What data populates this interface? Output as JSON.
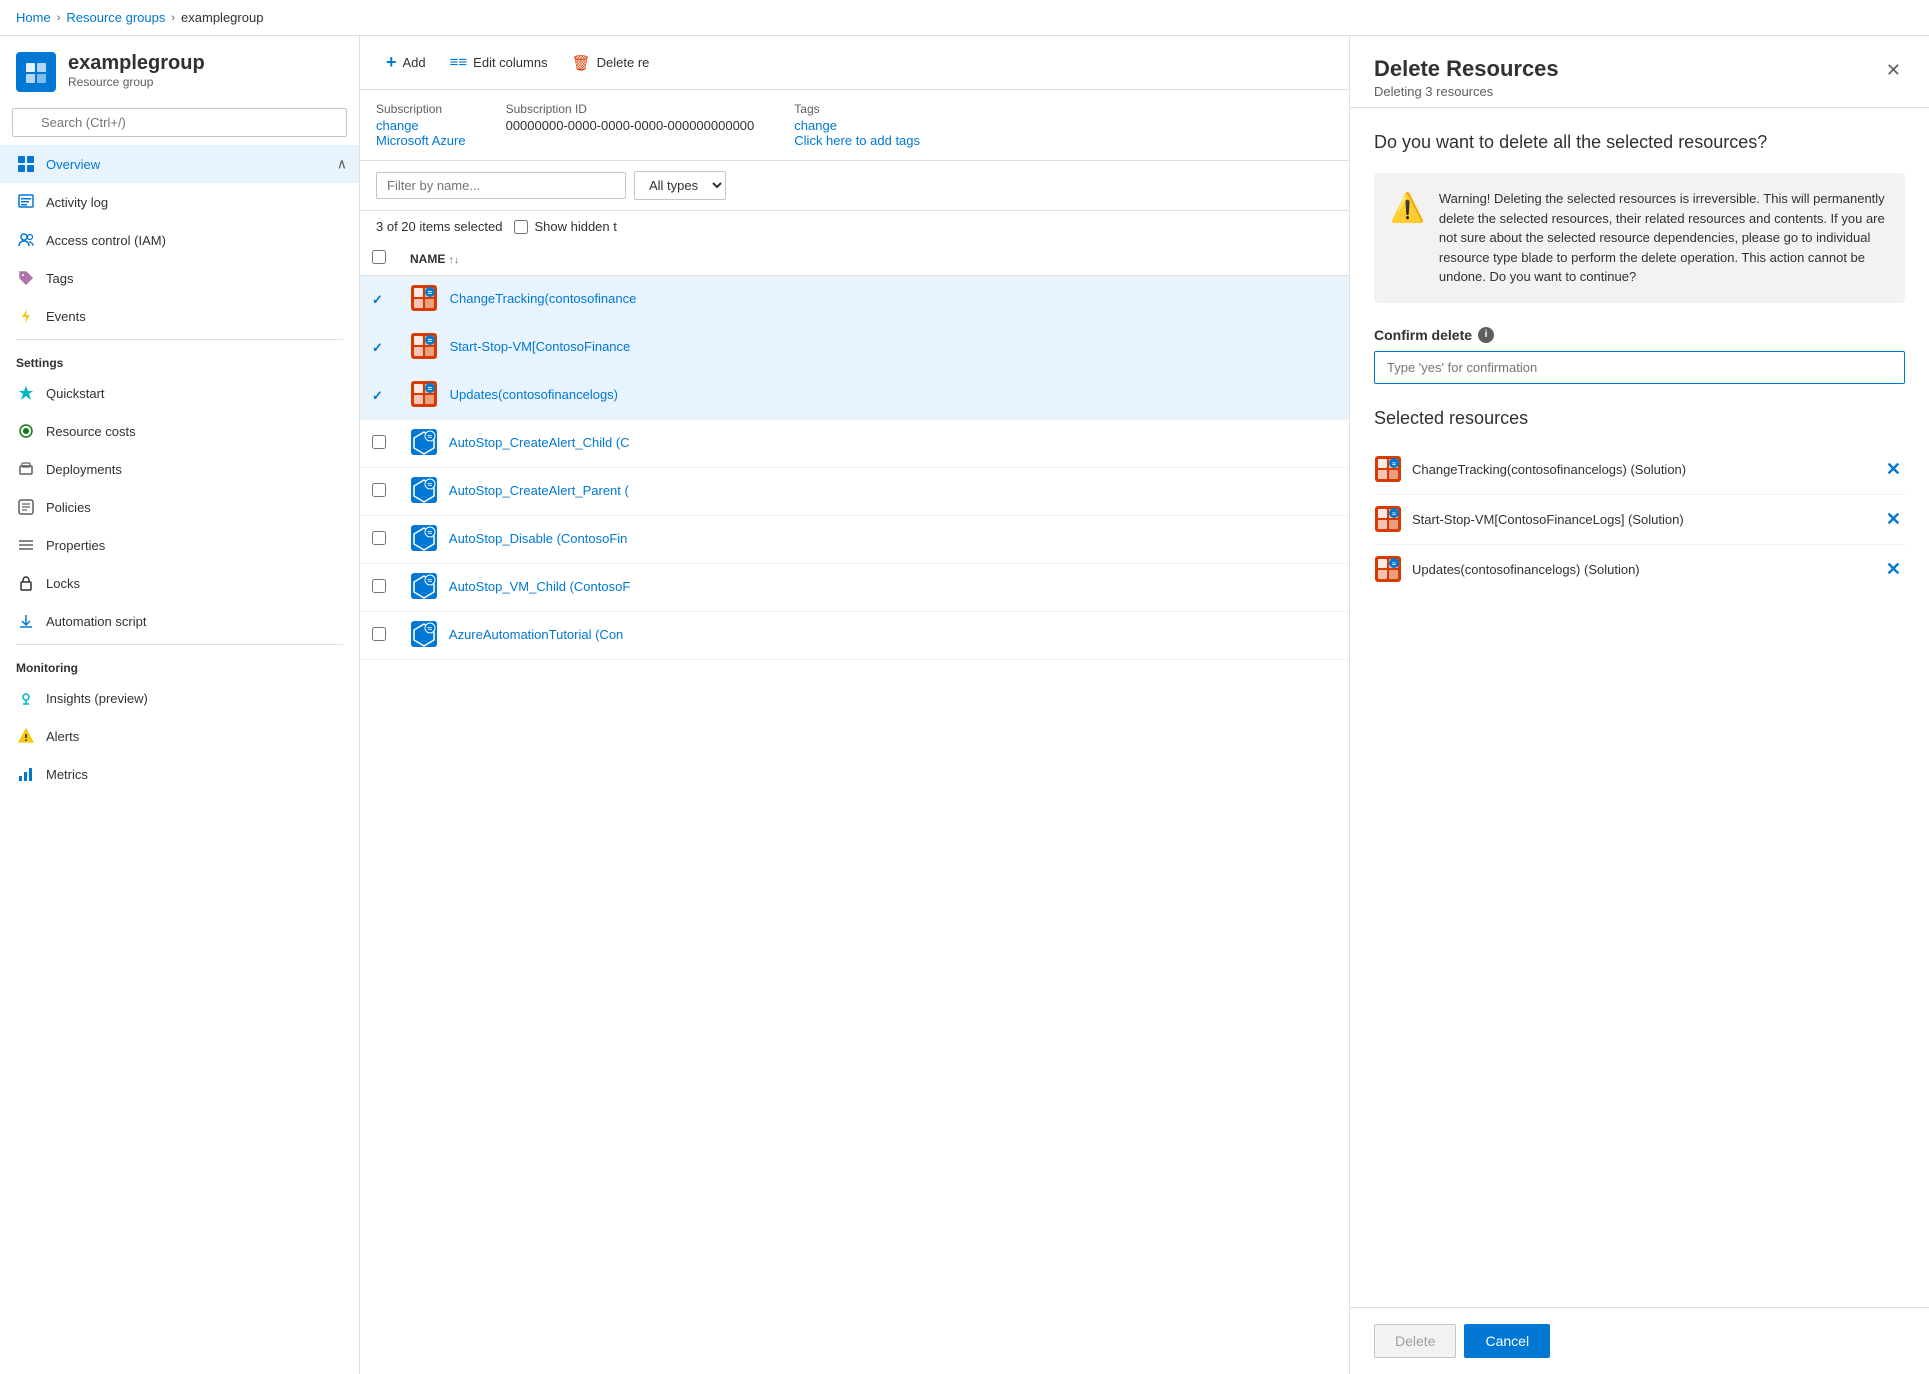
{
  "breadcrumb": {
    "home": "Home",
    "resource_groups": "Resource groups",
    "current": "examplegroup"
  },
  "sidebar": {
    "title": "examplegroup",
    "subtitle": "Resource group",
    "search_placeholder": "Search (Ctrl+/)",
    "collapse_tooltip": "Collapse",
    "nav_items": [
      {
        "id": "overview",
        "label": "Overview",
        "icon": "grid",
        "active": true
      },
      {
        "id": "activity-log",
        "label": "Activity log",
        "icon": "list"
      },
      {
        "id": "access-control",
        "label": "Access control (IAM)",
        "icon": "people"
      },
      {
        "id": "tags",
        "label": "Tags",
        "icon": "tag"
      },
      {
        "id": "events",
        "label": "Events",
        "icon": "bolt"
      }
    ],
    "settings_label": "Settings",
    "settings_items": [
      {
        "id": "quickstart",
        "label": "Quickstart",
        "icon": "star"
      },
      {
        "id": "resource-costs",
        "label": "Resource costs",
        "icon": "circle"
      },
      {
        "id": "deployments",
        "label": "Deployments",
        "icon": "deploy"
      },
      {
        "id": "policies",
        "label": "Policies",
        "icon": "policy"
      },
      {
        "id": "properties",
        "label": "Properties",
        "icon": "list-lines"
      },
      {
        "id": "locks",
        "label": "Locks",
        "icon": "lock"
      },
      {
        "id": "automation-script",
        "label": "Automation script",
        "icon": "download"
      }
    ],
    "monitoring_label": "Monitoring",
    "monitoring_items": [
      {
        "id": "insights",
        "label": "Insights (preview)",
        "icon": "lightbulb"
      },
      {
        "id": "alerts",
        "label": "Alerts",
        "icon": "bell"
      },
      {
        "id": "metrics",
        "label": "Metrics",
        "icon": "bar-chart"
      }
    ]
  },
  "toolbar": {
    "add_label": "Add",
    "edit_columns_label": "Edit columns",
    "delete_label": "Delete re"
  },
  "subscription": {
    "label": "Subscription",
    "change_link": "change",
    "value": "Microsoft Azure"
  },
  "subscription_id": {
    "label": "Subscription ID",
    "value": "00000000-0000-0000-0000-000000000000"
  },
  "tags": {
    "label": "Tags",
    "change_link": "change",
    "add_link": "Click here to add tags"
  },
  "filter": {
    "name_placeholder": "Filter by name...",
    "type_label": "All types"
  },
  "resources_count": {
    "selected": "3 of 20 items selected",
    "show_hidden": "Show hidden t"
  },
  "table": {
    "col_name": "NAME",
    "rows": [
      {
        "id": 1,
        "name": "ChangeTracking(contosofinance",
        "full_name": "ChangeTracking(contosofinancelogs) (Solution)",
        "checked": true,
        "icon_type": "solution-orange"
      },
      {
        "id": 2,
        "name": "Start-Stop-VM[ContosoFinance",
        "full_name": "Start-Stop-VM[ContosoFinanceLogs] (Solution)",
        "checked": true,
        "icon_type": "solution-orange"
      },
      {
        "id": 3,
        "name": "Updates(contosofinancelogs)",
        "full_name": "Updates(contosofinancelogs) (Solution)",
        "checked": true,
        "icon_type": "solution-orange"
      },
      {
        "id": 4,
        "name": "AutoStop_CreateAlert_Child (C",
        "full_name": "AutoStop_CreateAlert_Child (ContosoFinanceLogs)",
        "checked": false,
        "icon_type": "cube-blue"
      },
      {
        "id": 5,
        "name": "AutoStop_CreateAlert_Parent (",
        "full_name": "AutoStop_CreateAlert_Parent (ContosoFinanceLogs)",
        "checked": false,
        "icon_type": "cube-blue"
      },
      {
        "id": 6,
        "name": "AutoStop_Disable (ContosoFin",
        "full_name": "AutoStop_Disable (ContosoFinanceLogs)",
        "checked": false,
        "icon_type": "cube-blue"
      },
      {
        "id": 7,
        "name": "AutoStop_VM_Child (ContosoF",
        "full_name": "AutoStop_VM_Child (ContosoFinanceLogs)",
        "checked": false,
        "icon_type": "cube-blue"
      },
      {
        "id": 8,
        "name": "AzureAutomationTutorial (Con",
        "full_name": "AzureAutomationTutorial (ContosoFinanceLogs)",
        "checked": false,
        "icon_type": "cube-blue"
      }
    ]
  },
  "delete_panel": {
    "title": "Delete Resources",
    "subtitle": "Deleting 3 resources",
    "question": "Do you want to delete all the selected resources?",
    "warning_text": "Warning! Deleting the selected resources is irreversible. This will permanently delete the selected resources, their related resources and contents. If you are not sure about the selected resource dependencies, please go to individual resource type blade to perform the delete operation. This action cannot be undone. Do you want to continue?",
    "confirm_label": "Confirm delete",
    "confirm_placeholder": "Type 'yes' for confirmation",
    "selected_title": "Selected resources",
    "selected_items": [
      {
        "id": 1,
        "name": "ChangeTracking(contosofinancelogs) (Solution)"
      },
      {
        "id": 2,
        "name": "Start-Stop-VM[ContosoFinanceLogs] (Solution)"
      },
      {
        "id": 3,
        "name": "Updates(contosofinancelogs) (Solution)"
      }
    ],
    "delete_btn": "Delete",
    "cancel_btn": "Cancel"
  },
  "colors": {
    "accent": "#0078d4",
    "warning_orange": "#d83b01",
    "selected_bg": "#e8f4fd"
  }
}
